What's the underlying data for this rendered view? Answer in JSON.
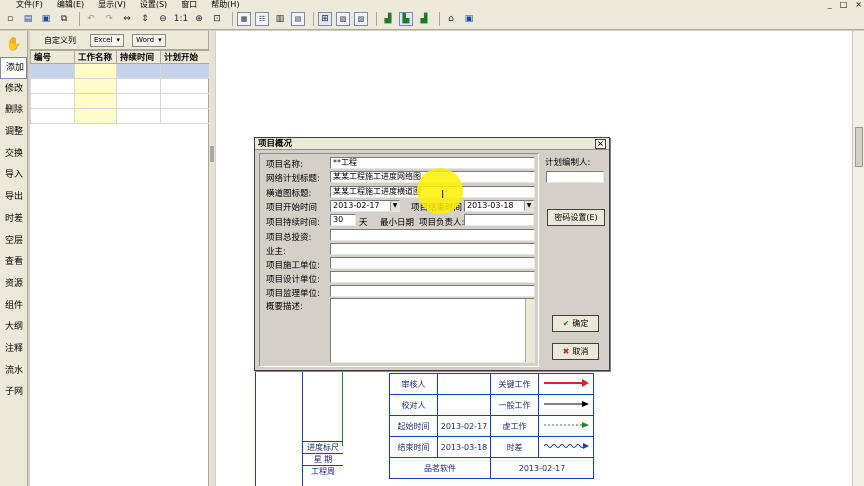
{
  "menu": {
    "items": [
      "文件(F)",
      "编辑(E)",
      "显示(V)",
      "设置(S)",
      "窗口",
      "帮助(H)"
    ],
    "window_controls": [
      "_",
      "□",
      "×"
    ]
  },
  "toolbar": {
    "zoom_reset_label": "1:1",
    "icons": [
      "new-icon",
      "open-icon",
      "save-icon",
      "copy-icon",
      "undo-icon",
      "redo-icon",
      "move-icon",
      "updown-icon",
      "zoom-out-icon",
      "zoom-reset-icon",
      "zoom-in-icon",
      "fit-icon",
      "grid-icon",
      "table-icon",
      "calendar-icon",
      "chart-icon",
      "network-icon",
      "layout-icon",
      "gantt-icon",
      "bar-chart-icon",
      "resource-icon",
      "home-icon",
      "print-icon"
    ]
  },
  "sidebar": {
    "hand_icon": "hand-icon",
    "items": [
      "添加",
      "修改",
      "删除",
      "调整",
      "交换",
      "导入",
      "导出",
      "时差",
      "空层",
      "查看",
      "资源",
      "组件",
      "大纲",
      "注释",
      "流水",
      "子网"
    ],
    "active_index": 0
  },
  "task_list": {
    "toolbar_label": "自定义列",
    "excel_label": "Excel",
    "word_label": "Word",
    "columns": [
      "编号",
      "工作名称",
      "持续时间",
      "计划开始"
    ]
  },
  "dialog": {
    "title": "项目概况",
    "close_label": "×",
    "fields": {
      "project_name_label": "项目名称:",
      "project_name_value": "**工程",
      "network_title_label": "网络计划标题:",
      "network_title_value": "某某工程施工进度网络图",
      "gantt_title_label": "横道图标题:",
      "gantt_title_value": "某某工程施工进度横道图",
      "start_label": "项目开始时间",
      "start_value": "2013-02-17",
      "end_label": "项目结束时间",
      "end_value": "2013-03-18",
      "duration_label": "项目持续时间:",
      "duration_value": "30",
      "duration_unit": "天",
      "min_date_label": "最小日期",
      "owner_label": "项目负责人:",
      "investment_label": "项目总投资:",
      "client_label": "业主:",
      "construction_label": "项目施工单位:",
      "design_label": "项目设计单位:",
      "supervision_label": "项目监理单位:",
      "summary_label": "概要描述:",
      "planner_label": "计划编制人:"
    },
    "buttons": {
      "password": "密码设置(E)",
      "ok": "确定",
      "cancel": "取消"
    }
  },
  "legend": {
    "rows": [
      {
        "left": "审核人",
        "mid": "",
        "type": "关键工作",
        "color": "#e02020",
        "style": "solid"
      },
      {
        "left": "校对人",
        "mid": "",
        "type": "一般工作",
        "color": "#000000",
        "style": "solid"
      },
      {
        "left": "起始时间",
        "mid": "2013-02-17",
        "type": "虚工作",
        "color": "#1a8a2a",
        "style": "dotted"
      },
      {
        "left": "结束时间",
        "mid": "2013-03-18",
        "type": "时差",
        "color": "#1a3dbd",
        "style": "wave"
      }
    ],
    "footer_company": "品茗软件",
    "footer_date": "2013-02-17",
    "side_labels": [
      "进度标尺",
      "星 期",
      "工程周"
    ]
  }
}
